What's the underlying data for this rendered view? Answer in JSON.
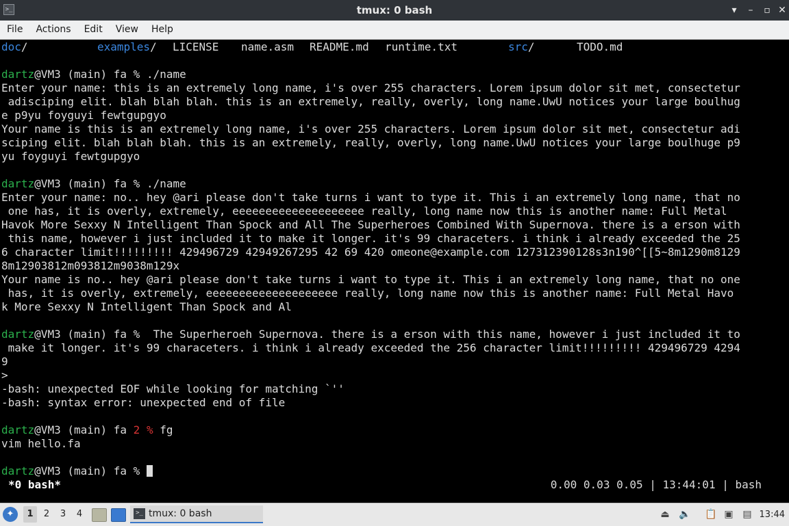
{
  "window": {
    "title": "tmux: 0 bash",
    "buttons": [
      "▾",
      "–",
      "▫",
      "✕"
    ]
  },
  "menu": [
    "File",
    "Actions",
    "Edit",
    "View",
    "Help"
  ],
  "terminal": {
    "ls": {
      "doc": "doc",
      "examples": "examples",
      "slash": "/",
      "license": "LICENSE",
      "name_asm": "name.asm",
      "readme": "README.md",
      "runtime": "runtime.txt",
      "src": "src",
      "todo": "TODO.md"
    },
    "prompt_user": "dartz",
    "prompt_rest": "@VM3 (main) fa ",
    "prompt_end": "%",
    "job_count": "2",
    "run1": {
      "cmd": " ./name",
      "lines": [
        "Enter your name: this is an extremely long name, i's over 255 characters. Lorem ipsum dolor sit met, consectetur",
        " adisciping elit. blah blah blah. this is an extremely, really, overly, long name.UwU notices your large boulhug",
        "e p9yu foyguyi fewtgupgyo",
        "Your name is this is an extremely long name, i's over 255 characters. Lorem ipsum dolor sit met, consectetur adi",
        "sciping elit. blah blah blah. this is an extremely, really, overly, long name.UwU notices your large boulhuge p9",
        "yu foyguyi fewtgupgyo"
      ]
    },
    "run2": {
      "cmd": " ./name",
      "lines": [
        "Enter your name: no.. hey @ari please don't take turns i want to type it. This i an extremely long name, that no",
        " one has, it is overly, extremely, eeeeeeeeeeeeeeeeeeee really, long name now this is another name: Full Metal",
        "Havok More Sexxy N Intelligent Than Spock and All The Superheroes Combined With Supernova. there is a erson with",
        " this name, however i just included it to make it longer. it's 99 characeters. i think i already exceeded the 25",
        "6 character limit!!!!!!!!! 429496729 42949267295 42 69 420 omeone@example.com 127312390128s3n190^[[5~8m1290m8129",
        "8m12903812m093812m9038m129x",
        "Your name is no.. hey @ari please don't take turns i want to type it. This i an extremely long name, that no one",
        " has, it is overly, extremely, eeeeeeeeeeeeeeeeeeee really, long name now this is another name: Full Metal Havo",
        "k More Sexxy N Intelligent Than Spock and Al"
      ]
    },
    "run3": {
      "cmd": "  The Superheroeh Supernova. there is a erson with this name, however i just included it to",
      "lines": [
        " make it longer. it's 99 characeters. i think i already exceeded the 256 character limit!!!!!!!!! 429496729 4294",
        "9",
        ">",
        "-bash: unexpected EOF while looking for matching `''",
        "-bash: syntax error: unexpected end of file"
      ]
    },
    "run4": {
      "cmd": " fg",
      "lines": [
        "vim hello.fa"
      ]
    }
  },
  "tmux_status": {
    "left": "*0 bash*",
    "right": "0.00 0.03 0.05 | 13:44:01 | bash"
  },
  "taskbar": {
    "workspaces": [
      "1",
      "2",
      "3",
      "4"
    ],
    "task_label": "tmux: 0 bash",
    "clock": "13:44"
  }
}
